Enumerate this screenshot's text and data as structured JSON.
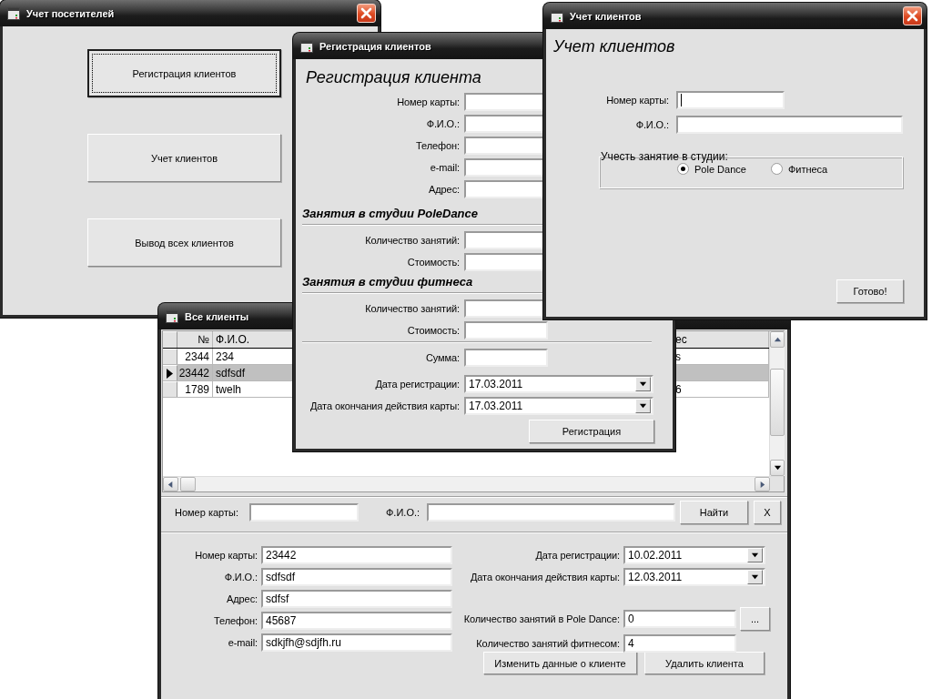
{
  "visitors_window": {
    "title": "Учет посетителей",
    "buttons": [
      {
        "label": "Регистрация клиентов",
        "focused": true
      },
      {
        "label": "Учет клиентов",
        "focused": false
      },
      {
        "label": "Вывод всех клиентов",
        "focused": false
      }
    ]
  },
  "registration_window": {
    "title": "Регистрация клиентов",
    "heading": "Регистрация клиента",
    "fields": [
      {
        "label": "Номер карты:"
      },
      {
        "label": "Ф.И.О.:"
      },
      {
        "label": "Телефон:"
      },
      {
        "label": "e-mail:"
      },
      {
        "label": "Адрес:"
      }
    ],
    "sections": [
      {
        "title": "Занятия в студии PoleDance",
        "fields": [
          {
            "label": "Количество занятий:"
          },
          {
            "label": "Стоимость:"
          }
        ]
      },
      {
        "title": "Занятия в студии фитнеса",
        "fields": [
          {
            "label": "Количество занятий:"
          },
          {
            "label": "Стоимость:"
          }
        ]
      }
    ],
    "sum": {
      "label": "Сумма:"
    },
    "dates": [
      {
        "label": "Дата регистрации:",
        "value": "17.03.2011"
      },
      {
        "label": "Дата окончания действия карты:",
        "value": "17.03.2011"
      }
    ],
    "submit_button": "Регистрация"
  },
  "accounting_window": {
    "title": "Учет клиентов",
    "heading": "Учет клиентов",
    "fields": [
      {
        "label": "Номер карты:",
        "focused": true
      },
      {
        "label": "Ф.И.О.:",
        "focused": false
      }
    ],
    "group": {
      "legend": "Учесть занятие в студии:",
      "options": [
        {
          "label": "Pole Dance",
          "selected": true
        },
        {
          "label": "Фитнеса",
          "selected": false
        }
      ]
    },
    "done_button": "Готово!"
  },
  "clients_window": {
    "title": "Все клиенты",
    "table": {
      "columns": [
        "№",
        "Ф.И.О.",
        "ес"
      ],
      "rows": [
        {
          "number": "2344",
          "name": "234",
          "column_3": "s",
          "selected": false
        },
        {
          "number": "23442",
          "name": "sdfsdf",
          "selected": true
        },
        {
          "number": "1789",
          "name": "twelh",
          "column_3": "6",
          "selected": false
        }
      ]
    },
    "search": {
      "card_label": "Номер карты:",
      "name_label": "Ф.И.О.:",
      "find_button": "Найти",
      "clear_button": "X"
    },
    "details": {
      "fields": [
        {
          "label": "Номер карты:",
          "value": "23442"
        },
        {
          "label": "Ф.И.О.:",
          "value": "sdfsdf"
        },
        {
          "label": "Адрес:",
          "value": "sdfsf"
        },
        {
          "label": "Телефон:",
          "value": "45687"
        },
        {
          "label": "e-mail:",
          "value": "sdkjfh@sdjfh.ru"
        }
      ],
      "right_fields": [
        {
          "kind": "date",
          "label": "Дата регистрации:",
          "value": "10.02.2011"
        },
        {
          "kind": "date",
          "label": "Дата окончания действия карты:",
          "value": "12.03.2011"
        },
        {
          "kind": "count",
          "label": "Количество занятий в Pole Dance:",
          "value": "0",
          "button": "..."
        },
        {
          "kind": "count",
          "label": "Количество занятий фитнесом:",
          "value": "4"
        }
      ],
      "buttons": [
        "Изменить данные о клиенте",
        "Удалить клиента"
      ]
    }
  }
}
